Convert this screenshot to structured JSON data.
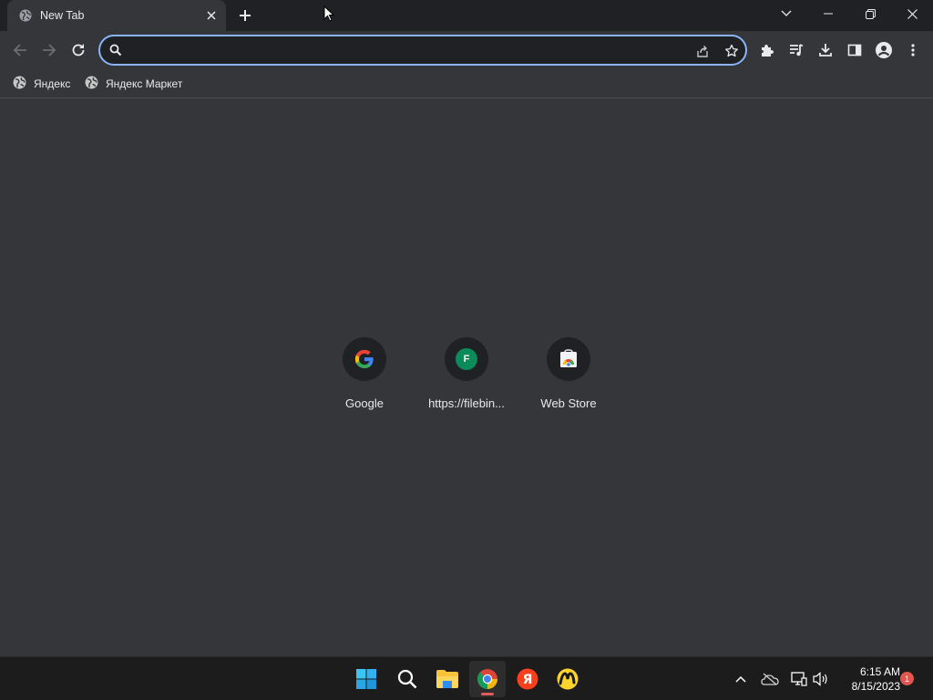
{
  "browser": {
    "tab": {
      "title": "New Tab"
    },
    "omnibox": {
      "value": "",
      "placeholder": ""
    },
    "bookmarks": [
      {
        "label": "Яндекс"
      },
      {
        "label": "Яндекс Маркет"
      }
    ]
  },
  "new_tab_page": {
    "shortcuts": [
      {
        "label": "Google",
        "icon": "google-g-icon"
      },
      {
        "label": "https://filebin...",
        "icon": "filebin-f-icon",
        "letter": "F"
      },
      {
        "label": "Web Store",
        "icon": "web-store-icon"
      }
    ]
  },
  "taskbar": {
    "clock": {
      "time": "6:15 AM",
      "date": "8/15/2023"
    },
    "notification_count": "1"
  },
  "colors": {
    "accent": "#8ab4f8",
    "background": "#35363a",
    "titlebar": "#202124",
    "taskbar": "#1c1c1c"
  }
}
